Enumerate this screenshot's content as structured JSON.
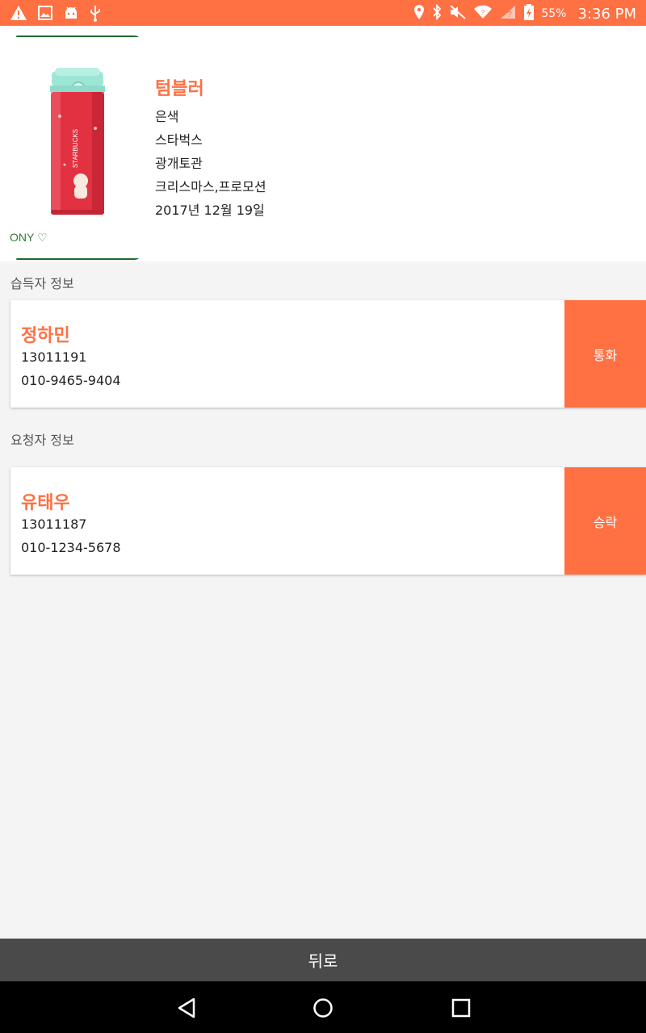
{
  "status_bar": {
    "battery_percent": "55%",
    "time": "3:36 PM",
    "left_icons": [
      "warning-icon",
      "image-icon",
      "android-icon",
      "usb-icon"
    ],
    "right_icons": [
      "location-icon",
      "bluetooth-icon",
      "mute-icon",
      "wifi-icon",
      "signal-icon",
      "battery-icon"
    ]
  },
  "item": {
    "image_caption": "ONY ♡",
    "title": "텀블러",
    "details": [
      "은색",
      "스타벅스",
      "광개토관",
      "크리스마스,프로모션",
      "2017년 12월 19일"
    ]
  },
  "finder": {
    "section_label": "습득자 정보",
    "name": "정하민",
    "student_id": "13011191",
    "phone": "010-9465-9404",
    "action_label": "통화"
  },
  "requester": {
    "section_label": "요청자 정보",
    "name": "유태우",
    "student_id": "13011187",
    "phone": "010-1234-5678",
    "action_label": "승락"
  },
  "footer": {
    "back_label": "뒤로"
  },
  "colors": {
    "accent": "#ff7043",
    "back_bar": "#4a4a4a",
    "nav_bar": "#000000"
  }
}
